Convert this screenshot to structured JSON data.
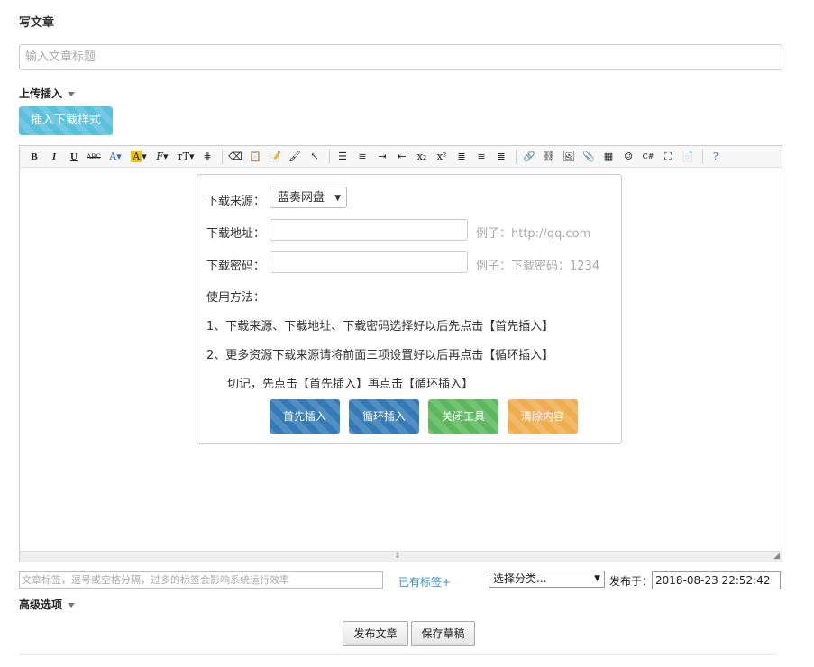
{
  "page_title": "写文章",
  "title_input": {
    "placeholder": "输入文章标题",
    "value": ""
  },
  "upload_insert": {
    "label": "上传插入"
  },
  "insert_download_style_button": {
    "label": "插入下载样式",
    "color": "#5bc0de"
  },
  "toolbar": {
    "items": [
      "bold-icon",
      "italic-icon",
      "underline-icon",
      "strikethrough-icon",
      "font-color-icon",
      "highlight-color-icon",
      "font-family-icon",
      "font-size-icon",
      "table-grid-icon",
      "eraser-icon",
      "paste-word-icon",
      "paste-text-icon",
      "format-brush-icon",
      "cursor-select-icon",
      "ordered-list-icon",
      "unordered-list-icon",
      "indent-icon",
      "outdent-icon",
      "subscript-icon",
      "superscript-icon",
      "align-left-icon",
      "align-center-icon",
      "align-right-icon",
      "link-icon",
      "unlink-icon",
      "image-icon",
      "attachment-icon",
      "table-icon",
      "emoji-icon",
      "code-icon",
      "fullscreen-icon",
      "paste-icon",
      "help-icon"
    ]
  },
  "download_panel": {
    "source_label": "下载来源：",
    "source_value": "蓝奏网盘",
    "address_label": "下载地址：",
    "address_hint": "例子：http://qq.com",
    "password_label": "下载密码：",
    "password_hint": "例子：下载密码：1234",
    "usage_title": "使用方法：",
    "usage_line1": "1、下载来源、下载地址、下载密码选择好以后先点击【首先插入】",
    "usage_line2": "2、更多资源下载来源请将前面三项设置好以后再点击【循环插入】",
    "usage_line3": "切记，先点击【首先插入】再点击【循环插入】",
    "buttons": {
      "first_insert": {
        "label": "首先插入",
        "color": "#337ab7"
      },
      "loop_insert": {
        "label": "循环插入",
        "color": "#337ab7"
      },
      "close_tool": {
        "label": "关闭工具",
        "color": "#5cb85c"
      },
      "clear_content": {
        "label": "清除内容",
        "color": "#f0ad4e"
      }
    }
  },
  "tags": {
    "placeholder": "文章标签，逗号或空格分隔，过多的标签会影响系统运行效率",
    "existing_link": "已有标签+"
  },
  "category_select": {
    "value": "选择分类..."
  },
  "publish_time": {
    "label": "发布于：",
    "value": "2018-08-23 22:52:42"
  },
  "advanced_options": {
    "label": "高级选项"
  },
  "actions": {
    "publish": "发布文章",
    "save_draft": "保存草稿"
  }
}
